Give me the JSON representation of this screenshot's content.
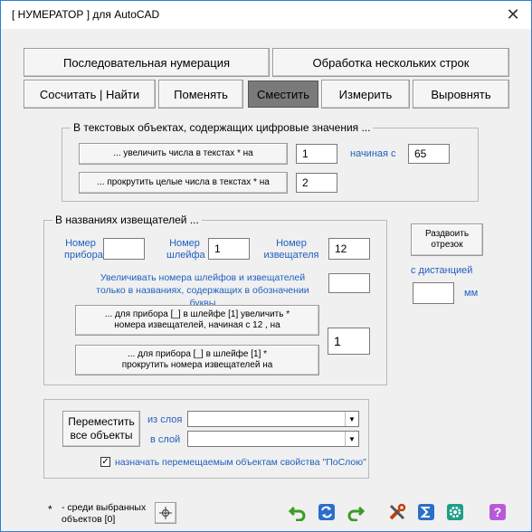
{
  "window": {
    "title": "[ НУМЕРАТОР ]  для AutoCAD",
    "close": "✕"
  },
  "tabs_top": [
    "Последовательная  нумерация",
    "Обработка  нескольких  строк"
  ],
  "tabs_bottom": [
    "Сосчитать | Найти",
    "Поменять",
    "Сместить",
    "Измерить",
    "Выровнять"
  ],
  "text_group": {
    "legend": "В текстовых объектах, содержащих цифровые значения ...",
    "increase_button": "... увеличить числа в текстах *  на",
    "increase_value": "1",
    "starting_label": "начиная с",
    "starting_value": "65",
    "scroll_button": "... прокрутить целые числа в текстах * на",
    "scroll_value": "2"
  },
  "detector_group": {
    "legend": "В названиях извещателей ...",
    "device_label": "Номер прибора",
    "device_value": "",
    "loop_label": "Номер шлейфа",
    "loop_value": "1",
    "detector_label": "Номер извещателя",
    "detector_value": "12",
    "letters_note": "Увеличивать номера шлейфов и извещателей только в названиях, содержащих в обозначении буквы",
    "letters_value": "",
    "increase_button": "... для прибора  [_]  в шлейфе  [1]  увеличить * номера извещателей, начиная  с 12 , на",
    "scroll_button": "... для  прибора  [_]  в шлейфе  [1]  * прокрутить номера извещателей на",
    "amount_value": "1"
  },
  "spread": {
    "button": "Раздвоить отрезок",
    "distance_label": "с  дистанцией",
    "distance_value": "",
    "unit": "мм"
  },
  "move_group": {
    "button": "Переместить все объекты",
    "from_layer_label": "из слоя",
    "to_layer_label": "в слой",
    "from_layer_value": "",
    "to_layer_value": "",
    "checkbox_label": "назначать перемещаемым объектам свойства \"ПоСлою\"",
    "checkbox_checked": true
  },
  "footer": {
    "note_star": "*",
    "note": "- среди выбранных объектов [0]"
  },
  "colors": {
    "accent_blue": "#1f5fbf",
    "active_tab": "#7a7a7a",
    "border": "#2b7fd6"
  }
}
